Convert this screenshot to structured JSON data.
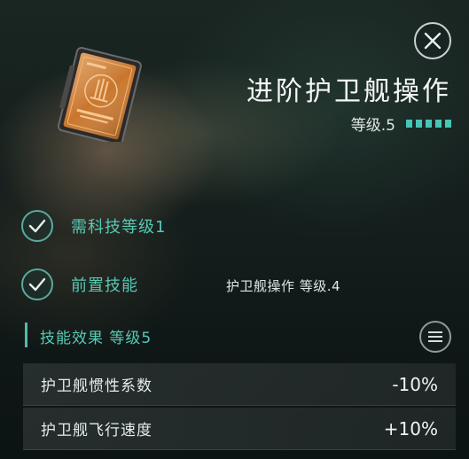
{
  "skill": {
    "title": "进阶护卫舰操作",
    "level_text": "等级.5",
    "level_pips": 5,
    "accent_color": "#46c7b5",
    "icon": "skillbook-icon"
  },
  "requirements": {
    "item1_label": "需科技等级1",
    "item2_label": "前置技能",
    "item2_value": "护卫舰操作 等级.4"
  },
  "effects": {
    "header": "技能效果 等级5",
    "rows": [
      {
        "name": "护卫舰惯性系数",
        "value": "-10%"
      },
      {
        "name": "护卫舰飞行速度",
        "value": "+10%"
      }
    ]
  },
  "icons": {
    "close": "close-icon",
    "check": "check-icon",
    "menu": "menu-icon"
  }
}
